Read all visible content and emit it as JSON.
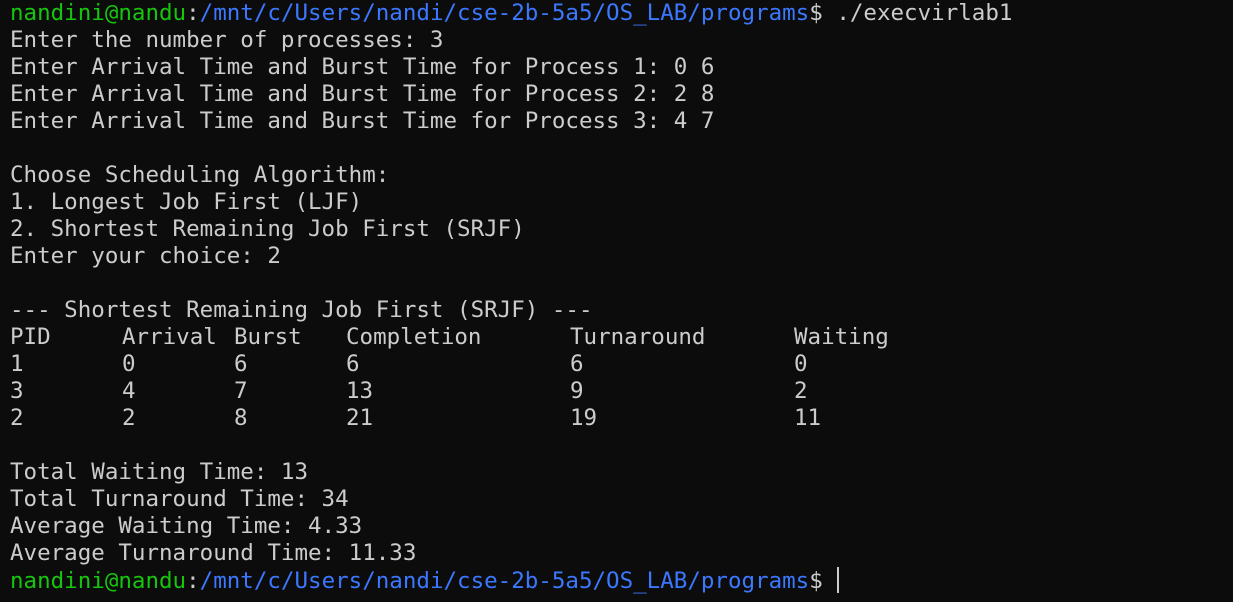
{
  "prompt": {
    "user_host": "nandini@nandu",
    "colon": ":",
    "path": "/mnt/c/Users/nandi/cse-2b-5a5/OS_LAB/programs",
    "symbol": "$",
    "command": " ./execvirlab1"
  },
  "input": {
    "num_processes": "Enter the number of processes: 3",
    "process_lines": [
      "Enter Arrival Time and Burst Time for Process 1: 0 6",
      "Enter Arrival Time and Burst Time for Process 2: 2 8",
      "Enter Arrival Time and Burst Time for Process 3: 4 7"
    ]
  },
  "menu": {
    "title": "Choose Scheduling Algorithm:",
    "options": [
      "1. Longest Job First (LJF)",
      "2. Shortest Remaining Job First (SRJF)"
    ],
    "choice": "Enter your choice: 2"
  },
  "result": {
    "heading": "--- Shortest Remaining Job First (SRJF) ---",
    "columns": [
      "PID",
      "Arrival",
      "Burst",
      "Completion",
      "Turnaround",
      "Waiting"
    ],
    "rows": [
      [
        "1",
        "0",
        "6",
        "6",
        "6",
        "0"
      ],
      [
        "3",
        "4",
        "7",
        "13",
        "9",
        "2"
      ],
      [
        "2",
        "2",
        "8",
        "21",
        "19",
        "11"
      ]
    ],
    "totals": [
      "Total Waiting Time: 13",
      "Total Turnaround Time: 34",
      "Average Waiting Time: 4.33",
      "Average Turnaround Time: 11.33"
    ]
  },
  "colors": {
    "background": "#0c0c0c",
    "text": "#cccccc",
    "prompt_user": "#16c60c",
    "prompt_path": "#3b78ff"
  }
}
